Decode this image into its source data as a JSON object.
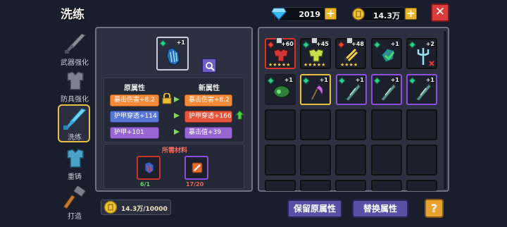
{
  "header": {
    "title": "洗练"
  },
  "currency": {
    "gems": "2019",
    "coins": "14.3万",
    "plus_glyph": "+",
    "close_glyph": "✕"
  },
  "sidebar": {
    "items": [
      {
        "label": "武器强化",
        "active": false
      },
      {
        "label": "防具强化",
        "active": false
      },
      {
        "label": "洗练",
        "active": true
      },
      {
        "label": "重铸",
        "active": false
      },
      {
        "label": "打造",
        "active": false
      }
    ]
  },
  "refine": {
    "item_plus": "+1",
    "original_header": "原属性",
    "new_header": "新属性",
    "original_stats": [
      "暴击伤害+8.2",
      "护甲穿透+114",
      "护甲+101"
    ],
    "new_stats": [
      "暴击伤害+8.2",
      "护甲穿透+166",
      "暴击值+39"
    ],
    "materials_header": "所需材料",
    "materials": [
      {
        "count": "6/1",
        "count_color": "#6fd16f"
      },
      {
        "count": "17/20",
        "count_color": "#e06a5a"
      }
    ],
    "cost": "14.3万/10000"
  },
  "inventory": {
    "items": [
      {
        "plus": "+60",
        "color": "red",
        "stars": "★★★★★"
      },
      {
        "plus": "+45",
        "color": "green",
        "stars": "★★★★★"
      },
      {
        "plus": "+48",
        "color": "red",
        "stars": "★★★★"
      },
      {
        "plus": "+1",
        "color": "green",
        "stars": ""
      },
      {
        "plus": "+2",
        "color": "green",
        "stars": ""
      },
      {
        "plus": "+1",
        "color": "green",
        "stars": ""
      },
      {
        "plus": "+1",
        "color": "green",
        "stars": ""
      },
      {
        "plus": "+1",
        "color": "green",
        "stars": ""
      },
      {
        "plus": "+1",
        "color": "green",
        "stars": ""
      },
      {
        "plus": "+1",
        "color": "green",
        "stars": ""
      }
    ]
  },
  "buttons": {
    "keep": "保留原属性",
    "replace": "替换属性",
    "help": "?"
  }
}
